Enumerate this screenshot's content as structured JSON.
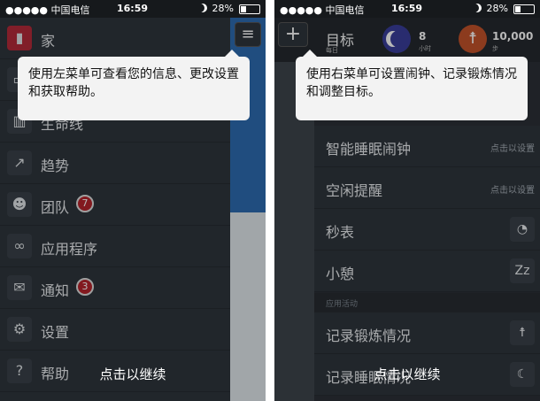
{
  "status": {
    "carrier": "●●●●● 中国电信",
    "time": "16:59",
    "battery": "28%"
  },
  "left": {
    "tooltip": "使用左菜单可查看您的信息、更改设置和获取帮助。",
    "continue": "点击以继续",
    "menu": [
      {
        "label": "家",
        "icon": "home-app-icon"
      },
      {
        "label": "",
        "icon": "chat-icon"
      },
      {
        "label": "生命线",
        "icon": "lifeline-icon"
      },
      {
        "label": "趋势",
        "icon": "trend-icon"
      },
      {
        "label": "团队",
        "icon": "team-icon",
        "badge": "7"
      },
      {
        "label": "应用程序",
        "icon": "apps-icon"
      },
      {
        "label": "通知",
        "icon": "mail-icon",
        "badge": "3"
      },
      {
        "label": "设置",
        "icon": "gear-icon"
      },
      {
        "label": "帮助",
        "icon": "help-icon"
      }
    ]
  },
  "right": {
    "header": {
      "title": "目标",
      "subtitle": "每日",
      "sleep_value": "8",
      "sleep_unit": "小时",
      "steps_value": "10,000",
      "steps_unit": "步"
    },
    "tooltip": "使用右菜单可设置闹钟、记录锻炼情况和调整目标。",
    "continue": "点击以继续",
    "items": [
      {
        "label": "智能睡眠闹钟",
        "hint": "点击以设置"
      },
      {
        "label": "空闲提醒",
        "hint": "点击以设置"
      },
      {
        "label": "秒表",
        "icon": "stopwatch-icon"
      },
      {
        "label": "小憩",
        "icon": "nap-icon"
      }
    ],
    "section": "应用活动",
    "activities": [
      {
        "label": "记录锻炼情况",
        "icon": "runner-icon"
      },
      {
        "label": "记录睡眠情况",
        "icon": "sleep-moon-icon"
      }
    ]
  }
}
